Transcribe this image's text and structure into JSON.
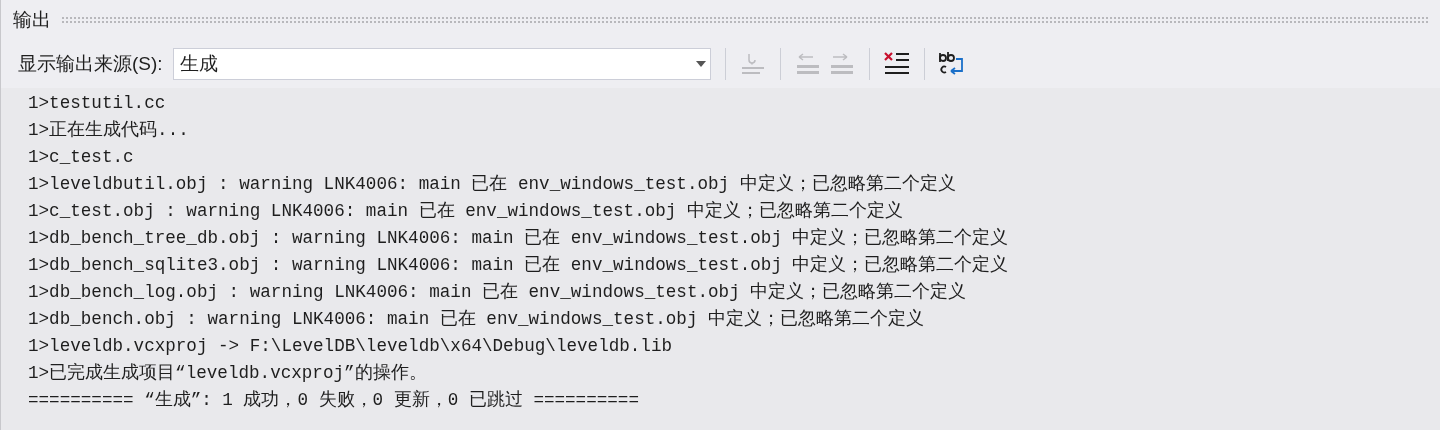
{
  "panel": {
    "title": "输出"
  },
  "toolbar": {
    "source_label": "显示输出来源(S):",
    "source_value": "生成",
    "buttons": [
      {
        "kind": "goto",
        "disabled": true
      },
      {
        "kind": "prev",
        "disabled": true
      },
      {
        "kind": "next",
        "disabled": true
      },
      {
        "kind": "clear",
        "disabled": false
      },
      {
        "kind": "wrap",
        "disabled": false
      }
    ]
  },
  "output_lines": [
    "1>testutil.cc",
    "1>正在生成代码...",
    "1>c_test.c",
    "1>leveldbutil.obj : warning LNK4006: main 已在 env_windows_test.obj 中定义；已忽略第二个定义",
    "1>c_test.obj : warning LNK4006: main 已在 env_windows_test.obj 中定义；已忽略第二个定义",
    "1>db_bench_tree_db.obj : warning LNK4006: main 已在 env_windows_test.obj 中定义；已忽略第二个定义",
    "1>db_bench_sqlite3.obj : warning LNK4006: main 已在 env_windows_test.obj 中定义；已忽略第二个定义",
    "1>db_bench_log.obj : warning LNK4006: main 已在 env_windows_test.obj 中定义；已忽略第二个定义",
    "1>db_bench.obj : warning LNK4006: main 已在 env_windows_test.obj 中定义；已忽略第二个定义",
    "1>leveldb.vcxproj -> F:\\LevelDB\\leveldb\\x64\\Debug\\leveldb.lib",
    "1>已完成生成项目“leveldb.vcxproj”的操作。",
    "========== “生成”: 1 成功，0 失败，0 更新，0 已跳过 =========="
  ]
}
